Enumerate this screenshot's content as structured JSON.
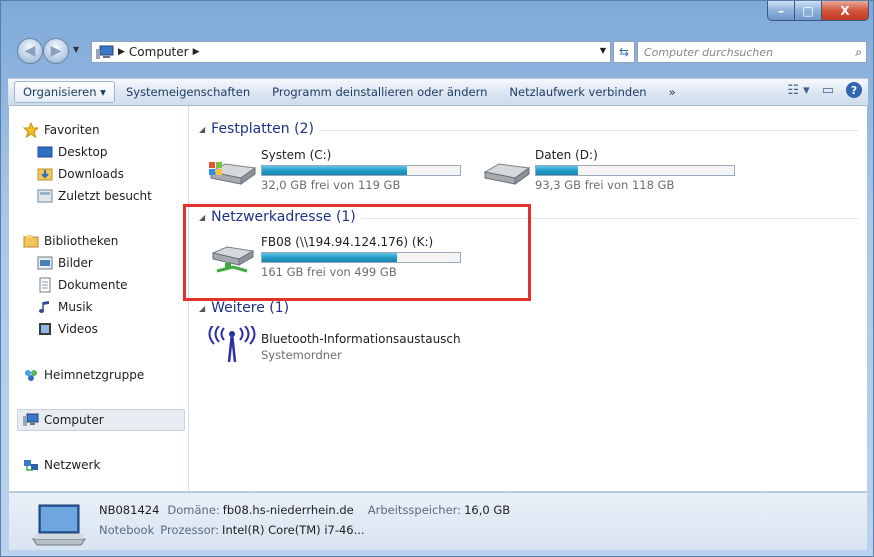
{
  "window": {
    "caption_buttons": [
      "–",
      "□",
      "X"
    ]
  },
  "address_bar": {
    "crumbs": [
      "Computer"
    ],
    "search_placeholder": "Computer durchsuchen"
  },
  "toolbar": {
    "organize": "Organisieren ▾",
    "items": [
      "Systemeigenschaften",
      "Programm deinstallieren oder ändern",
      "Netzlaufwerk verbinden"
    ],
    "more": "»"
  },
  "nav": {
    "favorites": "Favoriten",
    "fav_items": [
      "Desktop",
      "Downloads",
      "Zuletzt besucht"
    ],
    "libraries": "Bibliotheken",
    "lib_items": [
      "Bilder",
      "Dokumente",
      "Musik",
      "Videos"
    ],
    "homegroup": "Heimnetzgruppe",
    "computer": "Computer",
    "network": "Netzwerk"
  },
  "content": {
    "groups": [
      {
        "title": "Festplatten (2)",
        "drives": [
          {
            "name": "System (C:)",
            "free": "32,0 GB frei von 119 GB",
            "used_fraction": 0.73
          },
          {
            "name": "Daten (D:)",
            "free": "93,3 GB frei von 118 GB",
            "used_fraction": 0.21
          }
        ]
      },
      {
        "title": "Netzwerkadresse (1)",
        "drives": [
          {
            "name": "FB08 (\\\\194.94.124.176) (K:)",
            "free": "161 GB frei von 499 GB",
            "used_fraction": 0.68
          }
        ]
      },
      {
        "title": "Weitere (1)",
        "items": [
          {
            "name": "Bluetooth-Informationsaustausch",
            "type": "Systemordner"
          }
        ]
      }
    ]
  },
  "details": {
    "name": "NB081424",
    "domain_label": "Domäne:",
    "domain": "fb08.hs-niederrhein.de",
    "memory_label": "Arbeitsspeicher:",
    "memory": "16,0 GB",
    "type": "Notebook",
    "cpu_label": "Prozessor:",
    "cpu": "Intel(R) Core(TM) i7-46..."
  },
  "colors": {
    "highlight_box": "#e2332a",
    "group_title": "#1e3287",
    "bar_fill": "#229ec8"
  }
}
